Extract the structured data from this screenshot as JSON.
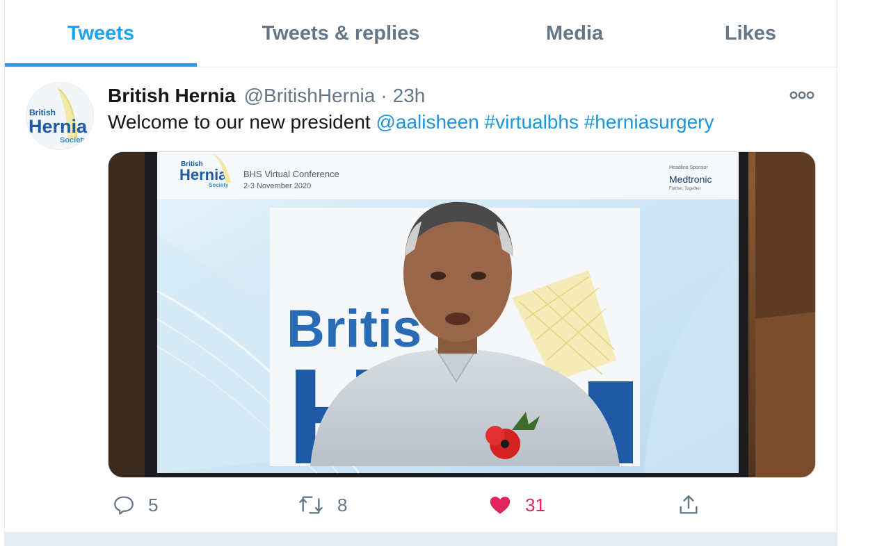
{
  "tabs": [
    {
      "label": "Tweets",
      "active": true
    },
    {
      "label": "Tweets & replies",
      "active": false
    },
    {
      "label": "Media",
      "active": false
    },
    {
      "label": "Likes",
      "active": false
    }
  ],
  "tweet": {
    "author_name": "British Hernia",
    "handle": "@BritishHernia",
    "separator": "·",
    "time": "23h",
    "text_plain": "Welcome to our new president ",
    "mention": "@aalisheen",
    "hashtags": [
      "#virtualbhs",
      "#herniasurgery"
    ],
    "avatar_logo": {
      "line1": "British",
      "line2": "Hernia",
      "line3": "Society"
    },
    "media": {
      "logo_small": {
        "line1": "British",
        "line2": "Hernia",
        "line3": "Society"
      },
      "conference_title": "BHS Virtual Conference",
      "conference_dates": "2-3 November 2020",
      "sponsor_label": "Headline Sponsor",
      "sponsor_name": "Medtronic",
      "sponsor_tagline": "Further, Together",
      "backdrop_text_1": "Britis",
      "backdrop_text_2": "H"
    },
    "actions": {
      "replies": "5",
      "retweets": "8",
      "likes": "31"
    }
  },
  "colors": {
    "accent": "#1da1f2",
    "link": "#1b95e0",
    "muted": "#657786",
    "like": "#e0245e",
    "border": "#e6ecf0"
  },
  "icons": [
    "more-icon",
    "reply-icon",
    "retweet-icon",
    "like-icon",
    "share-icon"
  ]
}
